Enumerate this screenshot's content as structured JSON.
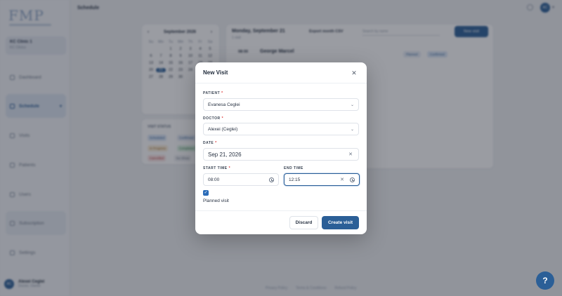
{
  "app": {
    "logo": "FMP",
    "page_title": "Schedule"
  },
  "sidebar": {
    "clinic_name": "KC Clinic 1",
    "clinic_sub": "KC Clinics",
    "items": [
      {
        "label": "Dashboard"
      },
      {
        "label": "Schedule"
      },
      {
        "label": "Visits"
      },
      {
        "label": "Patients"
      },
      {
        "label": "Users"
      },
      {
        "label": "Subscription"
      },
      {
        "label": "Settings"
      }
    ],
    "user_name": "Alexei Ceglei",
    "user_role": "Doctor, Owner",
    "user_initials": "AC"
  },
  "header": {
    "avatar_initials": "AC"
  },
  "calendar": {
    "month": "September 2026",
    "day_names": [
      "Su",
      "Mo",
      "Tu",
      "We",
      "Th",
      "Fr",
      "Sa"
    ],
    "days": [
      "",
      "",
      "1",
      "2",
      "3",
      "4",
      "5",
      "6",
      "7",
      "8",
      "9",
      "10",
      "11",
      "12",
      "13",
      "14",
      "15",
      "16",
      "17",
      "18",
      "19",
      "20",
      "21",
      "22",
      "23",
      "24",
      "25",
      "26",
      "27",
      "28",
      "29",
      "30"
    ],
    "selected": "21"
  },
  "visit_status": {
    "title": "VISIT STATUS",
    "chips": [
      "Scheduled",
      "Confirmed",
      "In Progress",
      "Completed",
      "Cancelled",
      "No Show"
    ]
  },
  "schedule": {
    "date_title": "Monday, September 21",
    "visit_count": "1 visit",
    "export_label": "Export month CSV",
    "search_placeholder": "Search by name",
    "new_label": "New visit",
    "appointment": {
      "time": "08:00",
      "patient": "George Marcel",
      "badge1": "Planned",
      "badge2": "Confirmed"
    }
  },
  "footer_links": [
    "Privacy Policy",
    "Terms & Conditions",
    "Refund Policy"
  ],
  "modal": {
    "title": "New Visit",
    "patient_label": "PATIENT",
    "patient_value": "Evanesa Ceglei",
    "doctor_label": "DOCTOR",
    "doctor_value": "Alexei (Ceglei)",
    "date_label": "DATE",
    "date_value": "Sep 21, 2026",
    "start_label": "START TIME",
    "start_value": "08:00",
    "end_label": "END TIME",
    "end_value": "12:15",
    "planned_label": "Planned visit",
    "planned_checked": true,
    "discard_label": "Discard",
    "create_label": "Create visit"
  },
  "colors": {
    "primary": "#2b5f97",
    "required": "#dd3333"
  }
}
